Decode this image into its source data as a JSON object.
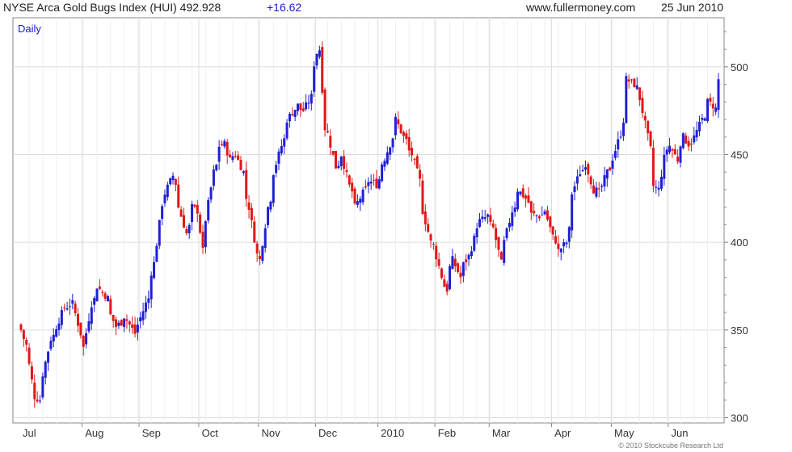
{
  "header": {
    "title": "NYSE Arca Gold Bugs Index (HUI) 492.928",
    "change": "+16.62",
    "website": "www.fullermoney.com",
    "date": "25 Jun 2010"
  },
  "footer": {
    "copyright": "© 2010 Stockcube Research Ltd"
  },
  "chart_data": {
    "type": "candlestick",
    "period": "Daily",
    "ylim": [
      297,
      528
    ],
    "yticks": [
      300,
      350,
      400,
      450,
      500
    ],
    "x_labels": [
      "Jul",
      "Aug",
      "Sep",
      "Oct",
      "Nov",
      "Dec",
      "2010",
      "Feb",
      "Mar",
      "Apr",
      "May",
      "Jun"
    ],
    "grid": true,
    "colors": {
      "up": "#1f1fd6",
      "down": "#e01818",
      "grid": "#dcdcdc",
      "axis": "#888888"
    },
    "last_close": 492.928,
    "change": 16.62,
    "anchors": [
      [
        "2009-07-01",
        350
      ],
      [
        "2009-07-02",
        345
      ],
      [
        "2009-07-06",
        330
      ],
      [
        "2009-07-08",
        312
      ],
      [
        "2009-07-10",
        310
      ],
      [
        "2009-07-13",
        325
      ],
      [
        "2009-07-16",
        345
      ],
      [
        "2009-07-20",
        352
      ],
      [
        "2009-07-23",
        363
      ],
      [
        "2009-07-28",
        365
      ],
      [
        "2009-07-31",
        348
      ],
      [
        "2009-08-03",
        340
      ],
      [
        "2009-08-06",
        365
      ],
      [
        "2009-08-10",
        375
      ],
      [
        "2009-08-14",
        368
      ],
      [
        "2009-08-19",
        352
      ],
      [
        "2009-08-24",
        358
      ],
      [
        "2009-08-28",
        348
      ],
      [
        "2009-08-31",
        353
      ],
      [
        "2009-09-03",
        365
      ],
      [
        "2009-09-04",
        368
      ],
      [
        "2009-09-08",
        388
      ],
      [
        "2009-09-11",
        422
      ],
      [
        "2009-09-14",
        428
      ],
      [
        "2009-09-17",
        438
      ],
      [
        "2009-09-21",
        420
      ],
      [
        "2009-09-24",
        405
      ],
      [
        "2009-09-28",
        420
      ],
      [
        "2009-09-30",
        418
      ],
      [
        "2009-10-02",
        395
      ],
      [
        "2009-10-05",
        413
      ],
      [
        "2009-10-08",
        440
      ],
      [
        "2009-10-12",
        455
      ],
      [
        "2009-10-14",
        456
      ],
      [
        "2009-10-16",
        447
      ],
      [
        "2009-10-20",
        450
      ],
      [
        "2009-10-23",
        440
      ],
      [
        "2009-10-27",
        420
      ],
      [
        "2009-10-30",
        393
      ],
      [
        "2009-11-02",
        390
      ],
      [
        "2009-11-05",
        420
      ],
      [
        "2009-11-09",
        440
      ],
      [
        "2009-11-12",
        455
      ],
      [
        "2009-11-16",
        470
      ],
      [
        "2009-11-20",
        478
      ],
      [
        "2009-11-24",
        475
      ],
      [
        "2009-11-27",
        483
      ],
      [
        "2009-12-01",
        508
      ],
      [
        "2009-12-02",
        510
      ],
      [
        "2009-12-04",
        465
      ],
      [
        "2009-12-07",
        462
      ],
      [
        "2009-12-10",
        443
      ],
      [
        "2009-12-14",
        450
      ],
      [
        "2009-12-17",
        432
      ],
      [
        "2009-12-21",
        420
      ],
      [
        "2009-12-24",
        428
      ],
      [
        "2009-12-28",
        435
      ],
      [
        "2009-12-31",
        433
      ],
      [
        "2010-01-05",
        448
      ],
      [
        "2010-01-08",
        460
      ],
      [
        "2010-01-11",
        470
      ],
      [
        "2010-01-14",
        460
      ],
      [
        "2010-01-19",
        450
      ],
      [
        "2010-01-22",
        435
      ],
      [
        "2010-01-25",
        418
      ],
      [
        "2010-01-28",
        400
      ],
      [
        "2010-02-01",
        392
      ],
      [
        "2010-02-04",
        375
      ],
      [
        "2010-02-05",
        373
      ],
      [
        "2010-02-09",
        390
      ],
      [
        "2010-02-12",
        380
      ],
      [
        "2010-02-17",
        392
      ],
      [
        "2010-02-19",
        402
      ],
      [
        "2010-02-23",
        412
      ],
      [
        "2010-02-26",
        415
      ],
      [
        "2010-03-02",
        408
      ],
      [
        "2010-03-05",
        388
      ],
      [
        "2010-03-08",
        400
      ],
      [
        "2010-03-11",
        418
      ],
      [
        "2010-03-15",
        430
      ],
      [
        "2010-03-18",
        425
      ],
      [
        "2010-03-22",
        416
      ],
      [
        "2010-03-25",
        415
      ],
      [
        "2010-03-29",
        418
      ],
      [
        "2010-04-01",
        403
      ],
      [
        "2010-04-05",
        395
      ],
      [
        "2010-04-08",
        400
      ],
      [
        "2010-04-12",
        428
      ],
      [
        "2010-04-15",
        440
      ],
      [
        "2010-04-19",
        445
      ],
      [
        "2010-04-22",
        430
      ],
      [
        "2010-04-26",
        428
      ],
      [
        "2010-04-29",
        440
      ],
      [
        "2010-05-03",
        448
      ],
      [
        "2010-05-06",
        462
      ],
      [
        "2010-05-10",
        493
      ],
      [
        "2010-05-13",
        490
      ],
      [
        "2010-05-17",
        482
      ],
      [
        "2010-05-20",
        460
      ],
      [
        "2010-05-24",
        432
      ],
      [
        "2010-05-26",
        430
      ],
      [
        "2010-05-28",
        448
      ],
      [
        "2010-06-01",
        455
      ],
      [
        "2010-06-04",
        447
      ],
      [
        "2010-06-08",
        460
      ],
      [
        "2010-06-10",
        456
      ],
      [
        "2010-06-14",
        460
      ],
      [
        "2010-06-17",
        470
      ],
      [
        "2010-06-21",
        480
      ],
      [
        "2010-06-23",
        478
      ],
      [
        "2010-06-24",
        476
      ],
      [
        "2010-06-25",
        492.928
      ]
    ]
  }
}
